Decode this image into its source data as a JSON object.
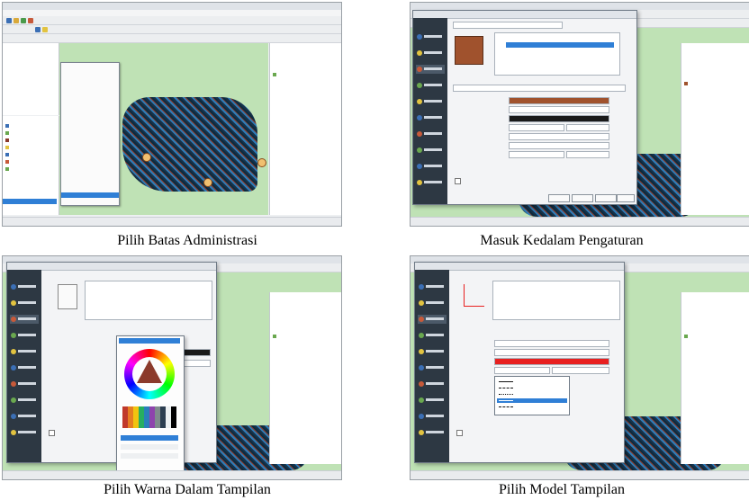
{
  "panels": [
    {
      "caption": "Pilih Batas Administrasi"
    },
    {
      "caption": "Masuk Kedalam Pengaturan"
    },
    {
      "caption": "Pilih Warna Dalam Tampilan"
    },
    {
      "caption": "Pilih Model Tampilan"
    }
  ],
  "colors": {
    "accent": "#2f7fd6",
    "map_green": "#bfe2b5",
    "fill_brown": "#a0522d",
    "stroke_red": "#e82020",
    "dialog_nav": "#2d3843"
  }
}
